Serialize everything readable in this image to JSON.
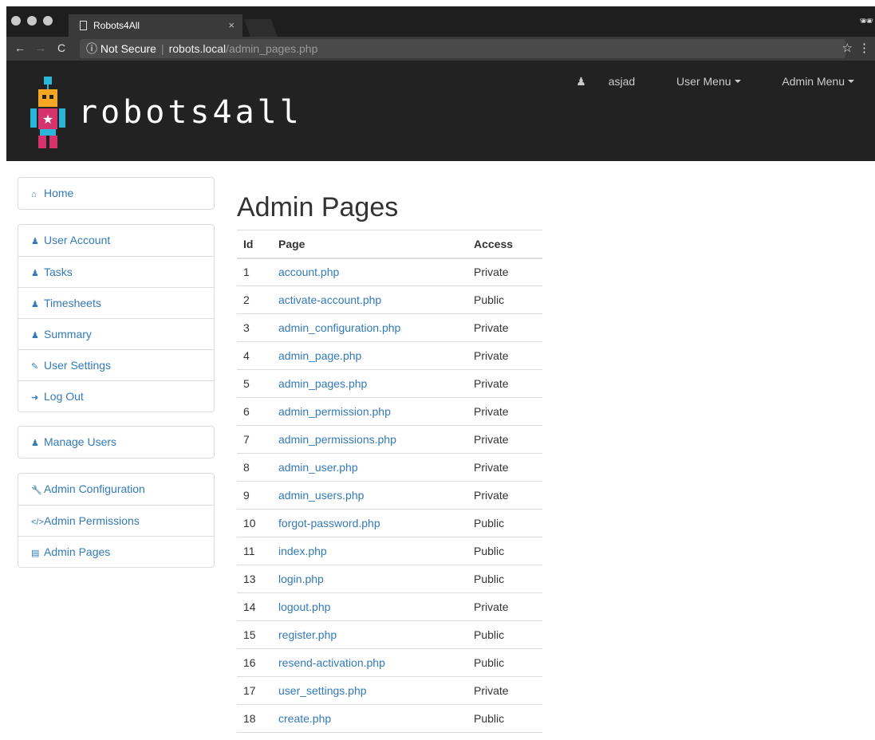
{
  "browser": {
    "tab_title": "Robots4All",
    "tab_close": "×",
    "secure_label": "ⓘ Not Secure",
    "url_host": "robots.local",
    "url_path": "/admin_pages.php"
  },
  "header": {
    "logo_text": "robots4all",
    "user_name": "asjad",
    "user_menu": "User Menu",
    "admin_menu": "Admin Menu"
  },
  "sidebar": {
    "group1": [
      {
        "label": "Home",
        "icon": "home-icon"
      }
    ],
    "group2": [
      {
        "label": "User Account",
        "icon": "user-icon"
      },
      {
        "label": "Tasks",
        "icon": "user-icon"
      },
      {
        "label": "Timesheets",
        "icon": "user-icon"
      },
      {
        "label": "Summary",
        "icon": "user-icon"
      },
      {
        "label": "User Settings",
        "icon": "edit-icon"
      },
      {
        "label": "Log Out",
        "icon": "logout-icon"
      }
    ],
    "group3": [
      {
        "label": "Manage Users",
        "icon": "users-icon"
      }
    ],
    "group4": [
      {
        "label": "Admin Configuration",
        "icon": "wrench-icon"
      },
      {
        "label": "Admin Permissions",
        "icon": "code-icon"
      },
      {
        "label": "Admin Pages",
        "icon": "list-icon"
      }
    ]
  },
  "main": {
    "title": "Admin Pages",
    "columns": [
      "Id",
      "Page",
      "Access"
    ],
    "rows": [
      [
        "1",
        "account.php",
        "Private"
      ],
      [
        "2",
        "activate-account.php",
        "Public"
      ],
      [
        "3",
        "admin_configuration.php",
        "Private"
      ],
      [
        "4",
        "admin_page.php",
        "Private"
      ],
      [
        "5",
        "admin_pages.php",
        "Private"
      ],
      [
        "6",
        "admin_permission.php",
        "Private"
      ],
      [
        "7",
        "admin_permissions.php",
        "Private"
      ],
      [
        "8",
        "admin_user.php",
        "Private"
      ],
      [
        "9",
        "admin_users.php",
        "Private"
      ],
      [
        "10",
        "forgot-password.php",
        "Public"
      ],
      [
        "11",
        "index.php",
        "Public"
      ],
      [
        "13",
        "login.php",
        "Public"
      ],
      [
        "14",
        "logout.php",
        "Private"
      ],
      [
        "15",
        "register.php",
        "Public"
      ],
      [
        "16",
        "resend-activation.php",
        "Public"
      ],
      [
        "17",
        "user_settings.php",
        "Private"
      ],
      [
        "18",
        "create.php",
        "Public"
      ]
    ]
  }
}
